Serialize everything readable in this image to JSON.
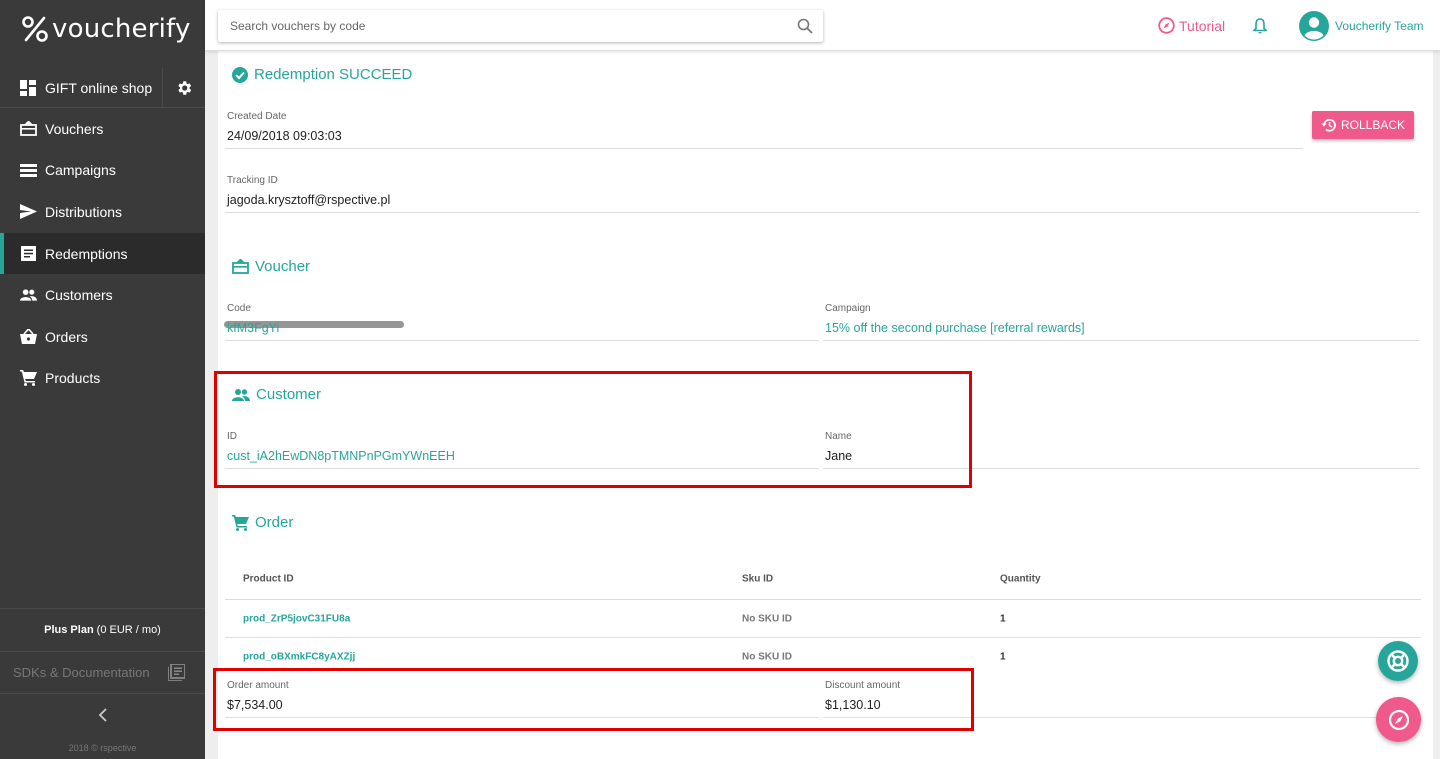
{
  "app": {
    "logo_text": "voucherify"
  },
  "sidebar": {
    "project": {
      "label": "GIFT online shop",
      "icon": "dashboard-icon"
    },
    "items": [
      {
        "label": "Vouchers",
        "icon": "voucher-icon"
      },
      {
        "label": "Campaigns",
        "icon": "campaigns-icon"
      },
      {
        "label": "Distributions",
        "icon": "send-icon"
      },
      {
        "label": "Redemptions",
        "icon": "redemptions-icon",
        "active": true
      },
      {
        "label": "Customers",
        "icon": "people-icon"
      },
      {
        "label": "Orders",
        "icon": "basket-icon"
      },
      {
        "label": "Products",
        "icon": "cart-icon"
      }
    ],
    "plan_name": "Plus Plan",
    "plan_price": "(0 EUR / mo)",
    "sdk_label": "SDKs & Documentation",
    "copyright": "2018 © rspective"
  },
  "topbar": {
    "search_placeholder": "Search vouchers by code",
    "tutorial_label": "Tutorial",
    "user_name": "Voucherify Team"
  },
  "redemption": {
    "title": "Redemption SUCCEED",
    "created_label": "Created Date",
    "created_value": "24/09/2018 09:03:03",
    "tracking_label": "Tracking ID",
    "tracking_value": "jagoda.krysztoff@rspective.pl",
    "rollback_label": "ROLLBACK"
  },
  "voucher": {
    "title": "Voucher",
    "code_label": "Code",
    "code_value": "kfM3FgYi",
    "campaign_label": "Campaign",
    "campaign_value": "15% off the second purchase [referral rewards]"
  },
  "customer": {
    "title": "Customer",
    "id_label": "ID",
    "id_value": "cust_iA2hEwDN8pTMNPnPGmYWnEEH",
    "name_label": "Name",
    "name_value": "Jane"
  },
  "order": {
    "title": "Order",
    "columns": [
      "Product ID",
      "Sku ID",
      "Quantity"
    ],
    "rows": [
      {
        "product": "prod_ZrP5jovC31FU8a",
        "sku": "No SKU ID",
        "qty": "1"
      },
      {
        "product": "prod_oBXmkFC8yAXZjj",
        "sku": "No SKU ID",
        "qty": "1"
      }
    ],
    "amount_label": "Order amount",
    "amount_value": "$7,534.00",
    "discount_label": "Discount amount",
    "discount_value": "$1,130.10"
  },
  "colors": {
    "accent": "#26a69a",
    "pink": "#f0598b",
    "sidebar": "#3a3a3a",
    "highlight": "#e00000"
  }
}
